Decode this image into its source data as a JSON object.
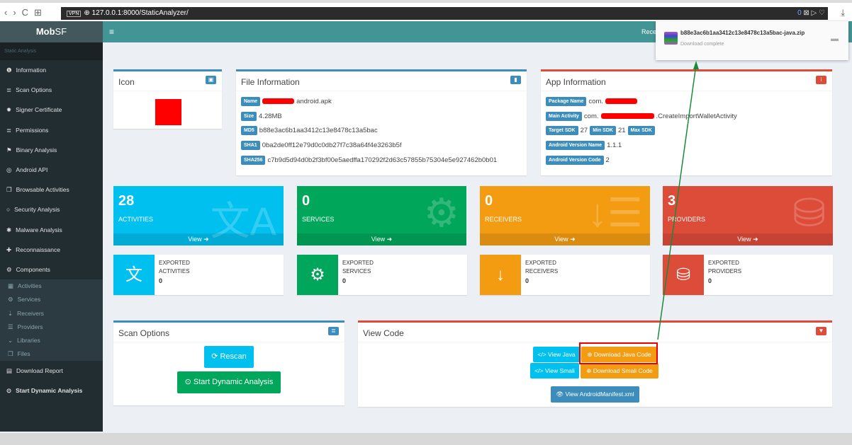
{
  "browser": {
    "url": "127.0.0.1:8000/StaticAnalyzer/",
    "vpn": "VPN",
    "badge": "0"
  },
  "download": {
    "filename": "b88e3ac6b1aa3412c13e8478c13a5bac-java.zip",
    "status": "Download complete"
  },
  "sidebar": {
    "logo_bold": "Mob",
    "logo_rest": "SF",
    "section": "Static Analysis",
    "items": [
      {
        "label": "Information",
        "icon": "info-icon"
      },
      {
        "label": "Scan Options",
        "icon": "list-icon"
      },
      {
        "label": "Signer Certificate",
        "icon": "certificate-icon"
      },
      {
        "label": "Permissions",
        "icon": "list-icon"
      },
      {
        "label": "Binary Analysis",
        "icon": "flag-icon"
      },
      {
        "label": "Android API",
        "icon": "circle-icon"
      },
      {
        "label": "Browsable Activities",
        "icon": "clone-icon"
      },
      {
        "label": "Security Analysis",
        "icon": "search-icon"
      },
      {
        "label": "Malware Analysis",
        "icon": "bug-icon"
      },
      {
        "label": "Reconnaissance",
        "icon": "plus-icon"
      },
      {
        "label": "Components",
        "icon": "cog-icon"
      }
    ],
    "subitems": [
      {
        "label": "Activities"
      },
      {
        "label": "Services"
      },
      {
        "label": "Receivers"
      },
      {
        "label": "Providers"
      },
      {
        "label": "Libraries"
      },
      {
        "label": "Files"
      }
    ],
    "download_report": "Download Report",
    "start_dynamic": "Start Dynamic Analysis"
  },
  "topbar": {
    "right": "Rece"
  },
  "icon_box": {
    "title": "Icon"
  },
  "file_info": {
    "title": "File Information",
    "rows": [
      {
        "label": "Name",
        "value": "android.apk"
      },
      {
        "label": "Size",
        "value": "4.28MB"
      },
      {
        "label": "MD5",
        "value": "b88e3ac6b1aa3412c13e8478c13a5bac"
      },
      {
        "label": "SHA1",
        "value": "0ba2de0ff12e79d0c0db27f7c38a64f4e3263b5f"
      },
      {
        "label": "SHA256",
        "value": "c7b9d5d94d0b2f3bf00e5aedffa170292f2d63c57855b75304e5e927462b0b01"
      }
    ]
  },
  "app_info": {
    "title": "App Information",
    "package_label": "Package Name",
    "package_value": "com.",
    "main_label": "Main Activity",
    "main_prefix": "com.",
    "main_suffix": ".CreateImportWalletActivity",
    "target_label": "Target SDK",
    "target_value": "27",
    "min_label": "Min SDK",
    "min_value": "21",
    "max_label": "Max SDK",
    "vname_label": "Android Version Name",
    "vname_value": "1.1.1",
    "vcode_label": "Android Version Code",
    "vcode_value": "2"
  },
  "stats": [
    {
      "count": "28",
      "label": "ACTIVITIES",
      "view": "View",
      "color": "#00c0ef"
    },
    {
      "count": "0",
      "label": "SERVICES",
      "view": "View",
      "color": "#00a65a"
    },
    {
      "count": "0",
      "label": "RECEIVERS",
      "view": "View",
      "color": "#f39c12"
    },
    {
      "count": "3",
      "label": "PROVIDERS",
      "view": "View",
      "color": "#dd4b39"
    }
  ],
  "exported": [
    {
      "l1": "EXPORTED",
      "l2": "ACTIVITIES",
      "value": "0"
    },
    {
      "l1": "EXPORTED",
      "l2": "SERVICES",
      "value": "0"
    },
    {
      "l1": "EXPORTED",
      "l2": "RECEIVERS",
      "value": "0"
    },
    {
      "l1": "EXPORTED",
      "l2": "PROVIDERS",
      "value": "0"
    }
  ],
  "scan_options": {
    "title": "Scan Options",
    "rescan": "Rescan",
    "start_dynamic": "Start Dynamic Analysis"
  },
  "view_code": {
    "title": "View Code",
    "view_java": "View Java",
    "download_java": "Download Java Code",
    "view_smali": "View Smali",
    "download_smali": "Download Smali Code",
    "manifest": "View AndroidManifest.xml"
  }
}
